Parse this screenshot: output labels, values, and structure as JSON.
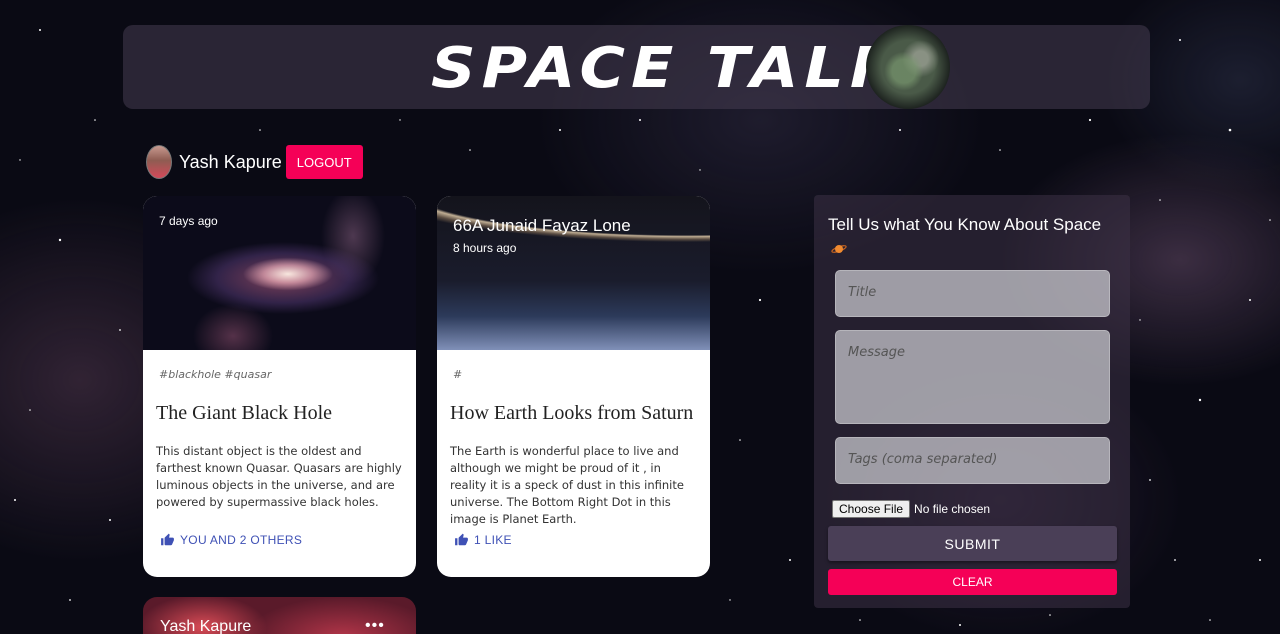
{
  "header": {
    "logo_text": "SPACE TALKS"
  },
  "user": {
    "name": "Yash Kapure",
    "logout_label": "LOGOUT"
  },
  "posts": [
    {
      "author": "",
      "time": "7 days ago",
      "tags": "#blackhole #quasar",
      "title": "The Giant Black Hole",
      "message": "This distant object is the oldest and farthest known Quasar. Quasars are highly luminous objects in the universe, and are powered by supermassive black holes.",
      "like_label": "YOU AND 2 OTHERS"
    },
    {
      "author": "66A Junaid Fayaz Lone",
      "time": "8 hours ago",
      "tags": "#",
      "title": "How Earth Looks from Saturn",
      "message": "The Earth is wonderful place to live and although we might be proud of it , in reality it is a speck of dust in this infinite universe. The Bottom Right Dot in this image is Planet Earth.",
      "like_label": "1 LIKE"
    },
    {
      "author": "Yash Kapure",
      "more_label": "•••"
    }
  ],
  "form": {
    "heading": "Tell Us what You Know About Space",
    "title_placeholder": "Title",
    "message_placeholder": "Message",
    "tags_placeholder": "Tags (coma separated)",
    "file_button_label": "Choose File",
    "file_status": "No file chosen",
    "submit_label": "SUBMIT",
    "clear_label": "CLEAR"
  },
  "colors": {
    "accent": "#f50057",
    "like": "#3f51b5",
    "submit": "#4a3f57"
  },
  "icons": {
    "like": "thumbs-up-icon",
    "planet": "ringed-planet-icon",
    "more": "more-horizontal-icon"
  }
}
